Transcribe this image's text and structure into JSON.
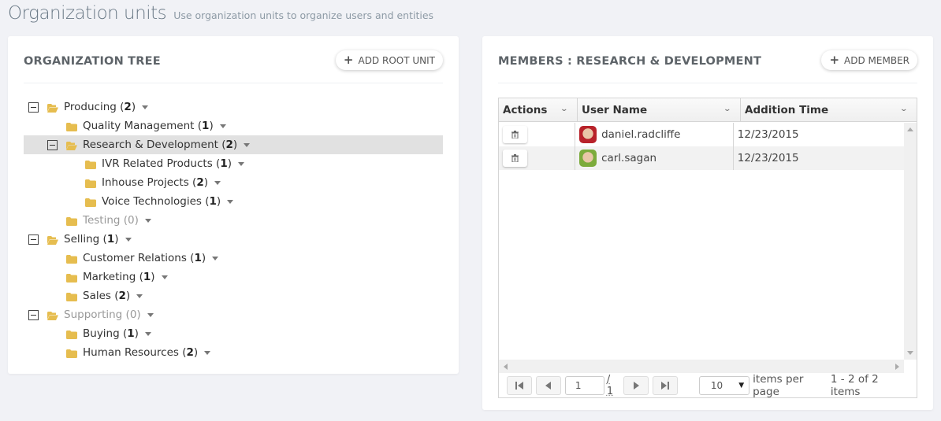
{
  "page": {
    "title": "Organization units",
    "subtitle": "Use organization units to organize users and entities"
  },
  "tree_panel": {
    "title": "ORGANIZATION TREE",
    "add_button": "ADD ROOT UNIT",
    "nodes": [
      {
        "name": "Producing",
        "count": "2",
        "level": 0,
        "expanded": true,
        "muted": false,
        "selected": false
      },
      {
        "name": "Quality Management",
        "count": "1",
        "level": 1,
        "expanded": false,
        "muted": false,
        "selected": false
      },
      {
        "name": "Research & Development",
        "count": "2",
        "level": 1,
        "expanded": true,
        "muted": false,
        "selected": true
      },
      {
        "name": "IVR Related Products",
        "count": "1",
        "level": 2,
        "expanded": false,
        "muted": false,
        "selected": false
      },
      {
        "name": "Inhouse Projects",
        "count": "2",
        "level": 2,
        "expanded": false,
        "muted": false,
        "selected": false
      },
      {
        "name": "Voice Technologies",
        "count": "1",
        "level": 2,
        "expanded": false,
        "muted": false,
        "selected": false
      },
      {
        "name": "Testing",
        "count": "0",
        "level": 1,
        "expanded": false,
        "muted": true,
        "selected": false
      },
      {
        "name": "Selling",
        "count": "1",
        "level": 0,
        "expanded": true,
        "muted": false,
        "selected": false
      },
      {
        "name": "Customer Relations",
        "count": "1",
        "level": 1,
        "expanded": false,
        "muted": false,
        "selected": false
      },
      {
        "name": "Marketing",
        "count": "1",
        "level": 1,
        "expanded": false,
        "muted": false,
        "selected": false
      },
      {
        "name": "Sales",
        "count": "2",
        "level": 1,
        "expanded": false,
        "muted": false,
        "selected": false
      },
      {
        "name": "Supporting",
        "count": "0",
        "level": 0,
        "expanded": true,
        "muted": true,
        "selected": false
      },
      {
        "name": "Buying",
        "count": "1",
        "level": 1,
        "expanded": false,
        "muted": false,
        "selected": false
      },
      {
        "name": "Human Resources",
        "count": "2",
        "level": 1,
        "expanded": false,
        "muted": false,
        "selected": false
      }
    ]
  },
  "members_panel": {
    "title": "MEMBERS : RESEARCH & DEVELOPMENT",
    "add_button": "ADD MEMBER",
    "columns": [
      "Actions",
      "User Name",
      "Addition Time"
    ],
    "rows": [
      {
        "user_name": "daniel.radcliffe",
        "addition_time": "12/23/2015",
        "avatar_color": "#b8222a"
      },
      {
        "user_name": "carl.sagan",
        "addition_time": "12/23/2015",
        "avatar_color": "#7cab3c"
      }
    ],
    "pager": {
      "page_value": "1",
      "of_pages": "/ 1",
      "page_size": "10",
      "page_size_label": "items per page",
      "info": "1 - 2 of 2 items"
    }
  },
  "colors": {
    "folder": "#e6bd4f",
    "selected_row": "#e1e1e1",
    "background": "#f1f2f6"
  }
}
